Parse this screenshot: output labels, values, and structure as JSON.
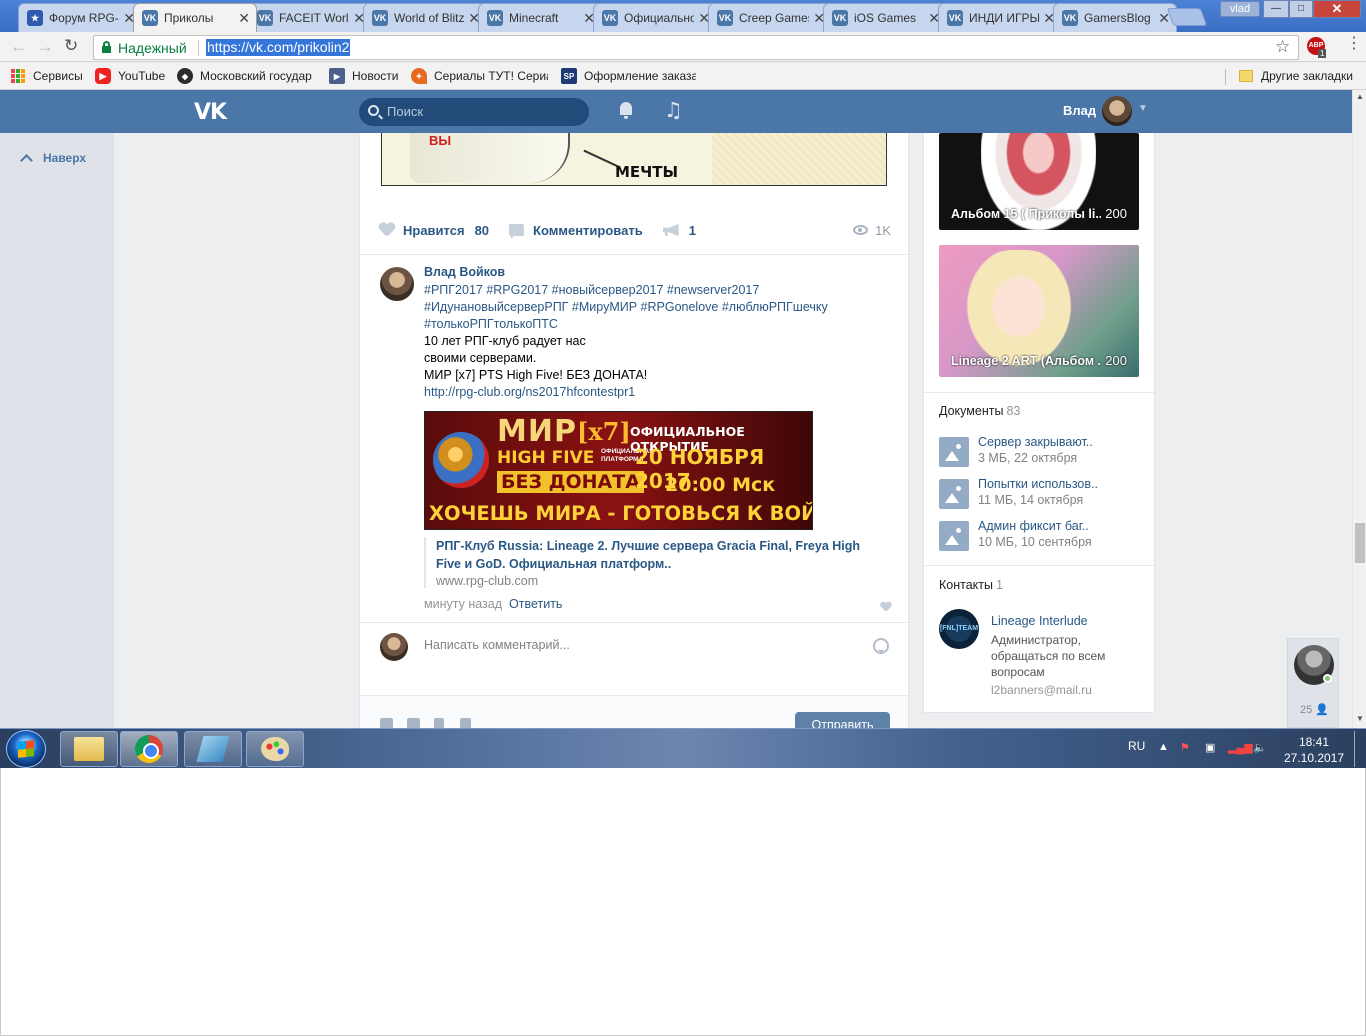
{
  "browser": {
    "tabs": [
      {
        "icon": "ru-forum-icon",
        "label": "Форум RPG-Club",
        "active": false
      },
      {
        "icon": "vk-icon",
        "label": "Приколы",
        "active": true
      },
      {
        "icon": "vk-icon",
        "label": "FACEIT World",
        "active": false
      },
      {
        "icon": "vk-icon",
        "label": "World of Blitz",
        "active": false
      },
      {
        "icon": "vk-icon",
        "label": "Minecraft",
        "active": false
      },
      {
        "icon": "vk-icon",
        "label": "Официальное",
        "active": false
      },
      {
        "icon": "vk-icon",
        "label": "Creep Games",
        "active": false
      },
      {
        "icon": "vk-icon",
        "label": "iOS Games",
        "active": false
      },
      {
        "icon": "vk-icon",
        "label": "ИНДИ ИГРЫ",
        "active": false
      },
      {
        "icon": "vk-icon",
        "label": "GamersBlog",
        "active": false
      }
    ],
    "tab_icon_text": "VK",
    "profile": "vlad",
    "window_controls": {
      "minimize": "—",
      "maximize": "□",
      "close": "✕"
    },
    "secure_label": "Надежный",
    "url": "https://vk.com/prikolin2",
    "extension_badge": "ABP",
    "extension_count": "1",
    "bookmarks": [
      {
        "label": "Сервисы",
        "icon": "apps-icon"
      },
      {
        "label": "YouTube",
        "icon": "youtube-icon"
      },
      {
        "label": "Московский государ",
        "icon": "moscow-icon"
      },
      {
        "label": "Новости",
        "icon": "news-icon"
      },
      {
        "label": "Сериалы ТУТ! Сериа",
        "icon": "serials-icon"
      },
      {
        "label": "Оформление заказа",
        "icon": "sp-icon"
      }
    ],
    "sp_icon_text": "SP",
    "other_bookmarks": "Другие закладки"
  },
  "vk": {
    "logo": "VK",
    "search_placeholder": "Поиск",
    "user_name": "Влад",
    "back_to_top": "Наверх"
  },
  "post": {
    "meme_text_you": "ВЫ",
    "meme_text_dreams": "МЕЧТЫ",
    "like_label": "Нравится",
    "like_count": "80",
    "comment_label": "Комментировать",
    "share_count": "1",
    "views": "1K"
  },
  "comment": {
    "author": "Влад Войков",
    "tags_line1": "#РПГ2017 #RPG2017 #новыйсервер2017 #newserver2017",
    "tags_line2": "#ИдунановыйсерверРПГ #МируМИР #RPGonelove #люблюРПГшечку",
    "tags_line3": "#толькоРПГтолькоПТС",
    "text_line1": "10 лет РПГ-клуб радует нас",
    "text_line2": "своими серверами.",
    "text_line3": "МИР [x7] PTS High Five! БЕЗ ДОНАТА!",
    "link": "http://rpg-club.org/ns2017hfcontestpr1",
    "banner": {
      "mir": "МИР",
      "x7": "[x7]",
      "high_five": "HIGH FIVE",
      "platform": "ОФИЦИАЛЬНАЯ ПЛАТФОРМА",
      "no_donate": "БЕЗ ДОНАТА",
      "opening": "ОФИЦИАЛЬНОЕ ОТКРЫТИЕ",
      "date": "20 НОЯБРЯ 2017",
      "time": "20:00 Мск",
      "slogan": "ХОЧЕШЬ МИРА - ГОТОВЬСЯ К ВОЙНЕ"
    },
    "snippet_title": "РПГ-Клуб Russia: Lineage 2. Лучшие сервера Gracia Final, Freya High Five и GoD. Официальная платформ..",
    "snippet_url": "www.rpg-club.com",
    "time": "минуту назад",
    "reply": "Ответить",
    "input_placeholder": "Написать комментарий...",
    "send": "Отправить"
  },
  "sidebar": {
    "albums": [
      {
        "label": "Альбом 15 ( Приколы li...",
        "count": "200"
      },
      {
        "label": "Lineage 2 ART (Альбом ...",
        "count": "200"
      }
    ],
    "documents_title": "Документы",
    "documents_count": "83",
    "documents": [
      {
        "name": "Сервер закрывают..",
        "meta": "3 МБ, 22 октября"
      },
      {
        "name": "Попытки использов..",
        "meta": "11 МБ, 14 октября"
      },
      {
        "name": "Админ фиксит баг..",
        "meta": "10 МБ, 10 сентября"
      }
    ],
    "contacts_title": "Контакты",
    "contacts_count": "1",
    "contact": {
      "avatar_text": "[FNL]TEAM",
      "name": "Lineage Interlude",
      "role": "Администратор, обращаться по всем вопросам",
      "email": "l2banners@mail.ru"
    }
  },
  "chat": {
    "count": "25"
  },
  "taskbar": {
    "language": "RU",
    "time": "18:41",
    "date": "27.10.2017"
  }
}
